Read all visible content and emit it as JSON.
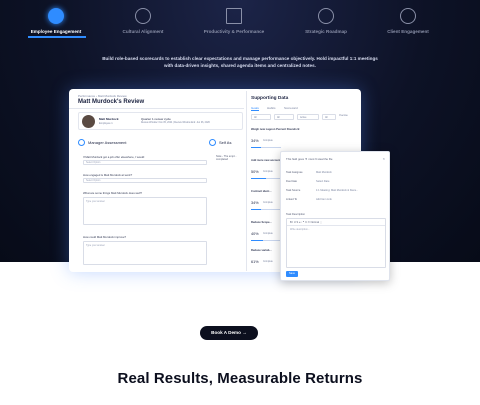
{
  "tabs": [
    {
      "label": "Employee Engagement",
      "icon": "engagement-icon",
      "active": true
    },
    {
      "label": "Cultural Alignment",
      "icon": "award-icon",
      "active": false
    },
    {
      "label": "Productivity & Performance",
      "icon": "bar-chart-icon",
      "active": false
    },
    {
      "label": "Strategic Roadmap",
      "icon": "target-icon",
      "active": false
    },
    {
      "label": "Client Engagement",
      "icon": "client-icon",
      "active": false
    }
  ],
  "hero": {
    "line1": "Build role-based scorecards to establish clear expectations and manage performance objectively. Hold impactful 1:1 meetings",
    "line2": "with data-driven insights, shared agenda items and centralized notes."
  },
  "review": {
    "breadcrumb": "Performance  ›  Matt Murdock Review",
    "title": "Matt Murdock's Review",
    "employee_name": "Matt Murdock",
    "employee_role": "Employee 1",
    "cycle": "Quarter 1 review cycle",
    "cycle_dates": "Review Window: Nov 05, 2024  |  Review Window End: Jun 06, 2026",
    "manager_heading": "Manager Assessment",
    "self_heading": "Self As",
    "q1": "If Matt Murdock got a job offer elsewhere, I would:",
    "q1_placeholder": "Select Option",
    "q2": "How engaged is Matt Murdock at work?",
    "q2_placeholder": "Select Option",
    "q3": "What are some things Matt Murdock does well?",
    "q3_placeholder": "Type your answer",
    "q4": "How could Matt Murdock improve?",
    "q4_placeholder": "Type your answer",
    "self_note": "Note - The empl... completed"
  },
  "support": {
    "title": "Supporting Data",
    "tabs": [
      "Goals",
      "Habits",
      "Scorecard"
    ],
    "active_tab": "Goals",
    "filters": [
      "All",
      "All",
      "Active",
      "All"
    ],
    "overdue_label": "Overdue",
    "metrics": [
      {
        "title": "Weigh new Lagoon Percent Rounds B",
        "value": "34%",
        "sub": "Complete",
        "progress": 0.34
      },
      {
        "title": "Add more new accounts",
        "value": "50%",
        "sub": "Complete",
        "progress": 0.5
      },
      {
        "title": "Contract ident...",
        "value": "34%",
        "sub": "Complete",
        "progress": 0.34
      },
      {
        "title": "Reduce Scope...",
        "value": "40%",
        "sub": "Complete",
        "progress": 0.4
      },
      {
        "title": "Reduce variab...",
        "value": "61%",
        "sub": "Complete",
        "progress": 0.61
      }
    ]
  },
  "panel": {
    "heading": "This field goes ▼ must 6 steal the file",
    "rows": [
      {
        "k": "Task Assignee",
        "v": "Matt Murdock"
      },
      {
        "k": "Due Date",
        "v": "Select Date"
      },
      {
        "k": "Task Source",
        "v": "1:1 Meeting: Matt Murdock & Kiera..."
      },
      {
        "k": "Linked To",
        "v": "Add Item Link"
      }
    ],
    "description_label": "Task Description",
    "toolbar": "B  I  U  S  ≡  ⁝  ❝  ⟲  ⟳    Normal   ⋮",
    "editor_placeholder": "Write description...",
    "save_label": "Save"
  },
  "cta": {
    "label": "Book A Demo  →"
  },
  "headline": "Real Results, Measurable Returns"
}
